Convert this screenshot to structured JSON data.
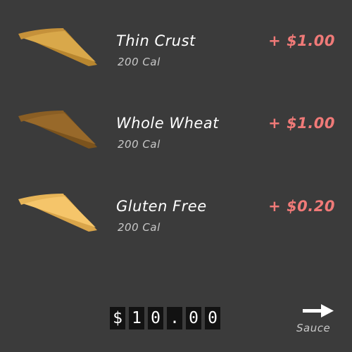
{
  "crust_options": [
    {
      "name": "Thin Crust",
      "calories": "200 Cal",
      "price": "+ $1.00",
      "icon": "thin-crust-slice-icon",
      "colors": {
        "top": "#d9a84a",
        "side": "#b8862f",
        "crust": "#c5913a"
      }
    },
    {
      "name": "Whole Wheat",
      "calories": "200 Cal",
      "price": "+ $1.00",
      "icon": "whole-wheat-slice-icon",
      "colors": {
        "top": "#98692a",
        "side": "#7b531d",
        "crust": "#8a5e24"
      }
    },
    {
      "name": "Gluten Free",
      "calories": "200 Cal",
      "price": "+ $0.20",
      "icon": "gluten-free-slice-icon",
      "colors": {
        "top": "#f5c56a",
        "side": "#d9a54a",
        "crust": "#e6b457"
      }
    }
  ],
  "total": {
    "digits": [
      "$",
      "1",
      "0",
      ".",
      "0",
      "0"
    ],
    "value": "$10.00"
  },
  "next": {
    "label": "Sauce",
    "icon": "right-arrow-icon"
  },
  "theme": {
    "background": "#3b3b3b",
    "price_color": "#f07a78"
  }
}
